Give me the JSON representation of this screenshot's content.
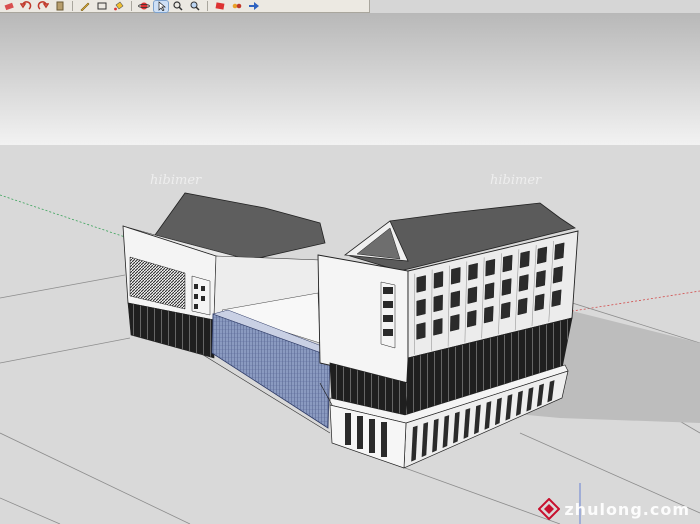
{
  "toolbar": {
    "buttons": [
      {
        "icon": "erase-icon"
      },
      {
        "icon": "undo-icon"
      },
      {
        "icon": "redo-icon"
      },
      {
        "icon": "paste-icon"
      },
      {
        "icon": "pencil-icon"
      },
      {
        "icon": "rectangle-icon"
      },
      {
        "icon": "paint-bucket-icon"
      },
      {
        "icon": "orbit-icon"
      },
      {
        "icon": "select-icon"
      },
      {
        "icon": "zoom-icon"
      },
      {
        "icon": "zoom-window-icon"
      },
      {
        "icon": "components-icon"
      },
      {
        "icon": "materials-icon"
      },
      {
        "icon": "scenes-icon"
      }
    ],
    "active": "select-icon"
  },
  "watermarks": {
    "faint": [
      "hibimer",
      "hibimer"
    ],
    "site_text": "zhulong.com"
  },
  "colors": {
    "sky": "#cfcfcf",
    "ground": "#d9d9d9",
    "roof": "#5e5e5e",
    "wall": "#f4f4f4",
    "glass": "#2a2a2a",
    "curtain": "#7f8fb1",
    "accent_red": "#c8102e"
  }
}
